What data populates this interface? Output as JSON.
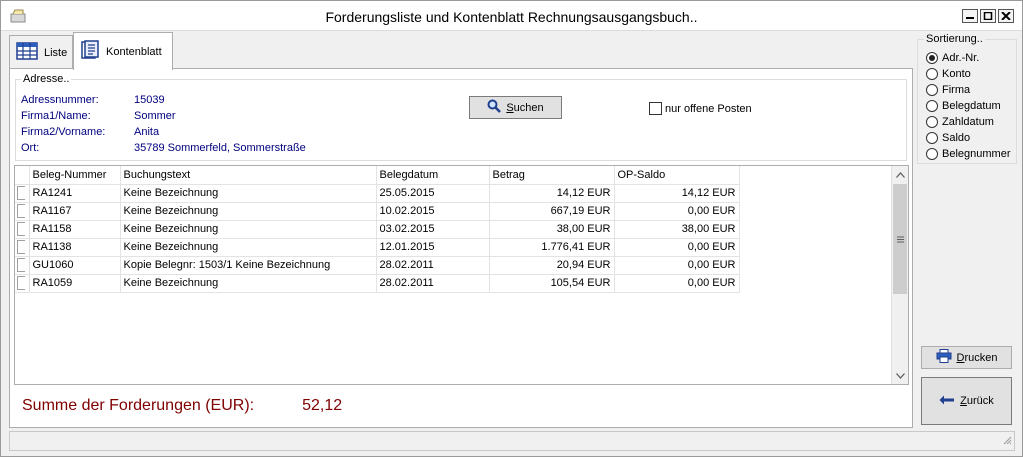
{
  "window": {
    "title": "Forderungsliste und Kontenblatt Rechnungsausgangsbuch.."
  },
  "tabs": [
    {
      "label": "Liste",
      "icon": "table-icon"
    },
    {
      "label": "Kontenblatt",
      "icon": "ledger-icon",
      "active": true
    }
  ],
  "address": {
    "legend": "Adresse..",
    "fields": [
      {
        "label": "Adressnummer:",
        "value": "15039"
      },
      {
        "label": "Firma1/Name:",
        "value": "Sommer"
      },
      {
        "label": "Firma2/Vorname:",
        "value": "Anita"
      },
      {
        "label": "Ort:",
        "value": "35789 Sommerfeld, Sommerstraße"
      }
    ]
  },
  "search": {
    "label_pre": "",
    "label_u": "S",
    "label_post": "uchen",
    "icon": "search-icon"
  },
  "filter": {
    "label": "nur offene Posten",
    "checked": false
  },
  "table": {
    "columns": [
      "Beleg-Nummer",
      "Buchungstext",
      "Belegdatum",
      "Betrag",
      "OP-Saldo"
    ],
    "rows": [
      [
        "RA1241",
        "Keine Bezeichnung",
        "25.05.2015",
        "14,12 EUR",
        "14,12 EUR"
      ],
      [
        "RA1167",
        "Keine Bezeichnung",
        "10.02.2015",
        "667,19 EUR",
        "0,00 EUR"
      ],
      [
        "RA1158",
        "Keine Bezeichnung",
        "03.02.2015",
        "38,00 EUR",
        "38,00 EUR"
      ],
      [
        "RA1138",
        "Keine Bezeichnung",
        "12.01.2015",
        "1.776,41 EUR",
        "0,00 EUR"
      ],
      [
        "GU1060",
        "Kopie Belegnr: 1503/1 Keine Bezeichnung",
        "28.02.2011",
        "20,94 EUR",
        "0,00 EUR"
      ],
      [
        "RA1059",
        "Keine Bezeichnung",
        "28.02.2011",
        "105,54 EUR",
        "0,00 EUR"
      ]
    ]
  },
  "summary": {
    "label": "Summe der Forderungen (EUR):",
    "value": "52,12",
    "color": "#800000"
  },
  "sorting": {
    "legend": "Sortierung..",
    "options": [
      "Adr.-Nr.",
      "Konto",
      "Firma",
      "Belegdatum",
      "Zahldatum",
      "Saldo",
      "Belegnummer"
    ],
    "selected_index": 0
  },
  "buttons": {
    "print": {
      "label_u": "D",
      "label_post": "rucken",
      "icon": "printer-icon"
    },
    "back": {
      "label_u": "Z",
      "label_post": "urück",
      "icon": "back-arrow-icon"
    }
  }
}
